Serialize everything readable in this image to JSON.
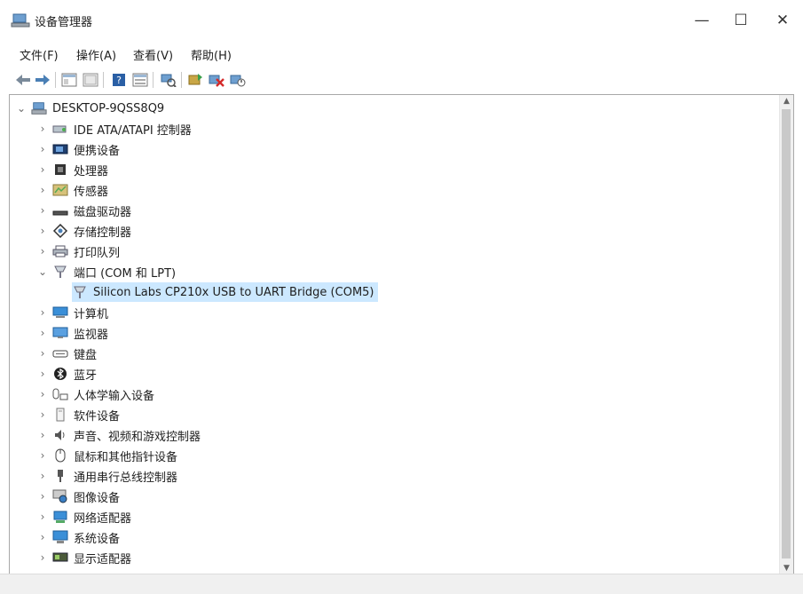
{
  "window": {
    "title": "设备管理器",
    "minimize": "—",
    "maximize": "☐",
    "close": "✕"
  },
  "menu": [
    "文件(F)",
    "操作(A)",
    "查看(V)",
    "帮助(H)"
  ],
  "toolbar": {
    "buttons": [
      "back-arrow-icon",
      "forward-arrow-icon",
      "show-hide-tree-icon",
      "properties-icon",
      "help-icon",
      "view-icon",
      "scan-hardware-icon",
      "update-driver-icon",
      "uninstall-device-icon",
      "enable-device-icon"
    ]
  },
  "tree": {
    "root": "DESKTOP-9QSS8Q9",
    "categories": [
      "IDE ATA/ATAPI 控制器",
      "便携设备",
      "处理器",
      "传感器",
      "磁盘驱动器",
      "存储控制器",
      "打印队列",
      "端口 (COM 和 LPT)",
      "计算机",
      "监视器",
      "键盘",
      "蓝牙",
      "人体学输入设备",
      "软件设备",
      "声音、视频和游戏控制器",
      "鼠标和其他指针设备",
      "通用串行总线控制器",
      "图像设备",
      "网络适配器",
      "系统设备",
      "显示适配器"
    ],
    "selected_child": "Silicon Labs CP210x USB to UART Bridge (COM5)"
  },
  "colors": {
    "selection": "#cce8ff",
    "text": "#1e1e1e"
  }
}
